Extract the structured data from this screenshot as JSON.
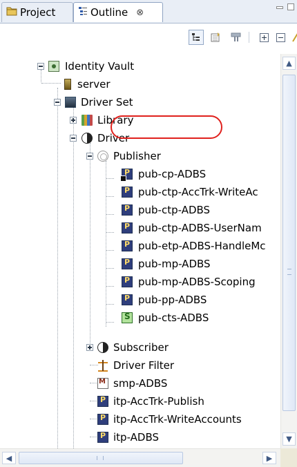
{
  "tabs": {
    "project": {
      "label": "Project",
      "icon": "project-icon"
    },
    "outline": {
      "label": "Outline",
      "icon": "outline-icon",
      "close": "⊗"
    }
  },
  "tree": {
    "identity_vault": "Identity Vault",
    "server": "server",
    "driver_set": "Driver Set",
    "library": "Library",
    "driver": "Driver",
    "publisher": "Publisher",
    "publisher_policies": [
      "pub-cp-ADBS",
      "pub-ctp-AccTrk-WriteAc",
      "pub-ctp-ADBS",
      "pub-ctp-ADBS-UserNam",
      "pub-etp-ADBS-HandleMc",
      "pub-mp-ADBS",
      "pub-mp-ADBS-Scoping",
      "pub-pp-ADBS",
      "pub-cts-ADBS"
    ],
    "subscriber": "Subscriber",
    "driver_filter": "Driver Filter",
    "driver_children": [
      "smp-ADBS",
      "itp-AccTrk-Publish",
      "itp-AccTrk-WriteAccounts",
      "itp-ADBS"
    ]
  },
  "scrollbars": {
    "up": "▲",
    "down": "▼",
    "left": "◀",
    "right": "▶"
  },
  "colors": {
    "highlight": "#e0201c",
    "tab_strip": "#e9eef6",
    "policy_icon": "#2f3e7c"
  }
}
